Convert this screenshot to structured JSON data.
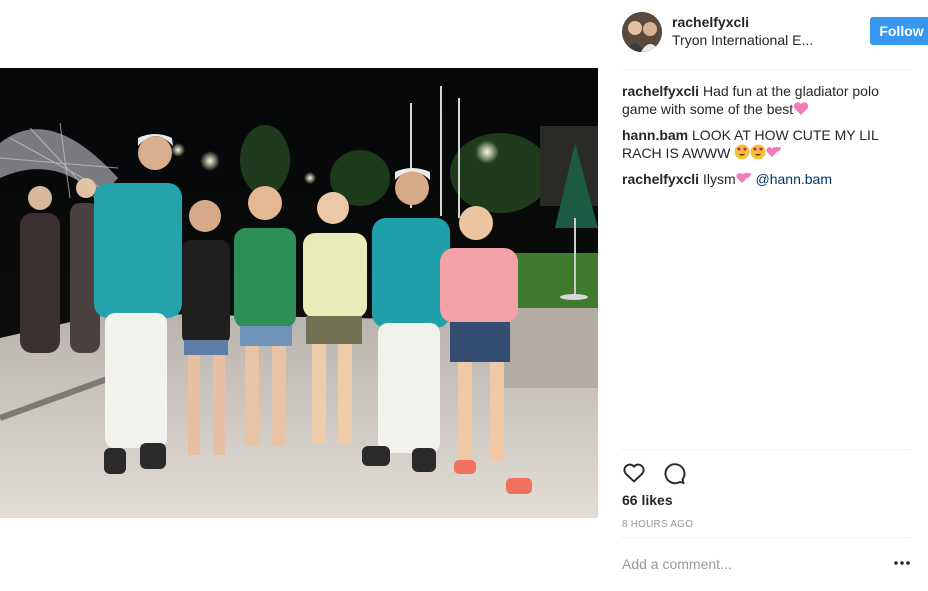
{
  "post": {
    "username": "rachelfyxcli",
    "location": "Tryon International E...",
    "follow_label": "Follow",
    "caption": {
      "user": "rachelfyxcli",
      "text": "Had fun at the gladiator polo game with some of the best"
    },
    "comments": [
      {
        "user": "hann.bam",
        "text": "LOOK AT HOW CUTE MY LIL RACH IS AWWW"
      },
      {
        "user": "rachelfyxcli",
        "text": "Ilysm",
        "mention": "@hann.bam"
      }
    ],
    "likes": "66 likes",
    "time": "8 HOURS AGO",
    "add_comment_placeholder": "Add a comment...",
    "more_label": "..."
  },
  "colors": {
    "follow_blue": "#3897f0",
    "mention": "#003569",
    "muted": "#999999",
    "divider": "#efefef"
  },
  "icons": [
    "heart-icon",
    "comment-icon",
    "more-options-icon",
    "pink-heart-emoji",
    "heart-eyes-emoji",
    "two-hearts-emoji"
  ]
}
